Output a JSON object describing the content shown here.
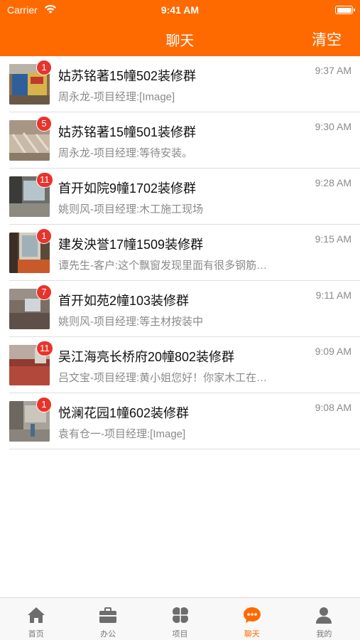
{
  "status_bar": {
    "carrier": "Carrier",
    "time": "9:41 AM"
  },
  "nav": {
    "title": "聊天",
    "clear_label": "清空"
  },
  "colors": {
    "accent": "#ff6a00",
    "badge": "#e8342b"
  },
  "chats": [
    {
      "name": "姑苏铭著15幢502装修群",
      "preview": "周永龙-项目经理:[Image]",
      "time": "9:37 AM",
      "unread": "1"
    },
    {
      "name": "姑苏铭著15幢501装修群",
      "preview": "周永龙-项目经理:等待安装。",
      "time": "9:30 AM",
      "unread": "5"
    },
    {
      "name": "首开如院9幢1702装修群",
      "preview": "姚则风-项目经理:木工施工现场",
      "time": "9:28 AM",
      "unread": "11"
    },
    {
      "name": "建发泱誉17幢1509装修群",
      "preview": "谭先生-客户:这个飘窗发现里面有很多钢筋…",
      "time": "9:15 AM",
      "unread": "1"
    },
    {
      "name": "首开如苑2幢103装修群",
      "preview": "姚则风-项目经理:等主材按装中",
      "time": "9:11 AM",
      "unread": "7"
    },
    {
      "name": "吴江海亮长桥府20幢802装修群",
      "preview": "吕文宝-项目经理:黄小姐您好！你家木工在…",
      "time": "9:09 AM",
      "unread": "11"
    },
    {
      "name": "悦澜花园1幢602装修群",
      "preview": "袁有仓一-项目经理:[Image]",
      "time": "9:08 AM",
      "unread": "1"
    }
  ],
  "tabs": [
    {
      "label": "首页",
      "icon": "home-icon"
    },
    {
      "label": "办公",
      "icon": "briefcase-icon"
    },
    {
      "label": "项目",
      "icon": "grid-icon"
    },
    {
      "label": "聊天",
      "icon": "chat-icon"
    },
    {
      "label": "我的",
      "icon": "person-icon"
    }
  ]
}
